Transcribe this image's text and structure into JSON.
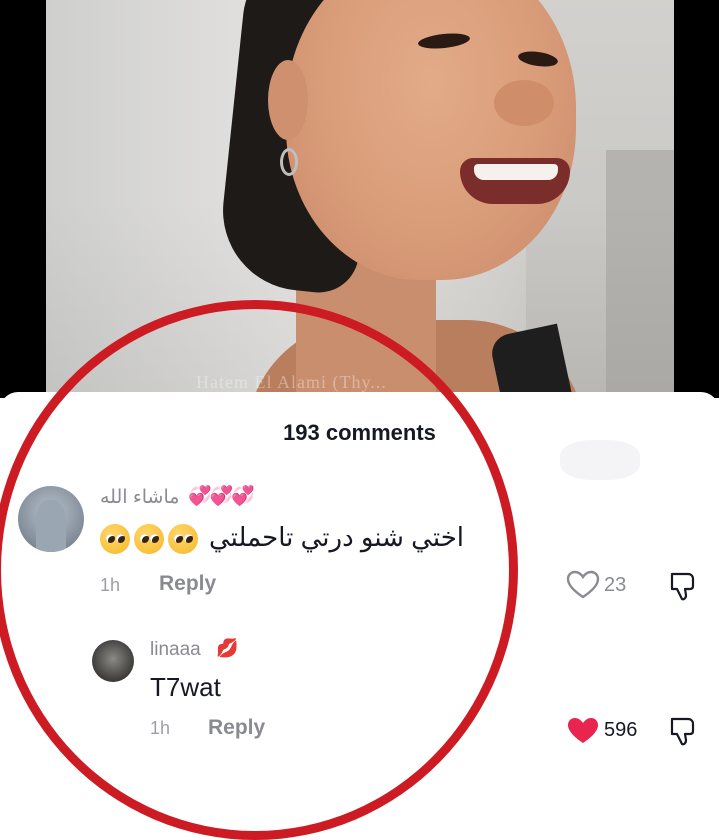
{
  "video": {
    "watermark": "Hatem El Alami (Thy..."
  },
  "comments": {
    "title": "193 comments",
    "items": [
      {
        "username": "ماشاء الله",
        "username_emoji": "💞💞💞",
        "text": "اختي شنو درتي تاحملتي",
        "trailing_emoji": "🥺🥺🥺",
        "time": "1h",
        "reply_label": "Reply",
        "likes": "23",
        "liked": false
      }
    ],
    "replies": [
      {
        "username": "linaaa",
        "username_emoji": "💋",
        "text": "T7wat",
        "time": "1h",
        "reply_label": "Reply",
        "likes": "596",
        "liked": true
      }
    ]
  },
  "colors": {
    "highlight_circle": "#cc1b22",
    "liked_heart": "#e8244f",
    "text_primary": "#161823",
    "text_secondary": "#8a8b91"
  }
}
